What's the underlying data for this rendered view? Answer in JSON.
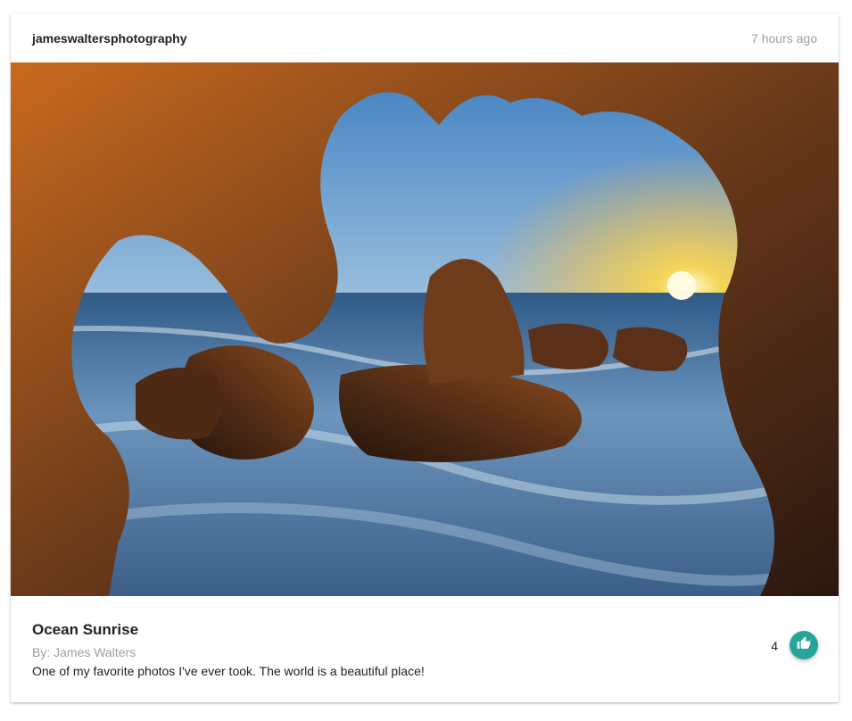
{
  "post": {
    "username": "jameswaltersphotography",
    "timestamp": "7 hours ago",
    "image": {
      "alt": "Ocean Sunrise"
    },
    "title": "Ocean Sunrise",
    "author": "By: James Walters",
    "description": "One of my favorite photos I've ever took. The world is a beautiful place!",
    "likes": "4",
    "like_icon": "thumb-up-icon"
  },
  "colors": {
    "accent": "#26a69a",
    "muted_text": "#9e9e9e",
    "text": "#222222"
  }
}
